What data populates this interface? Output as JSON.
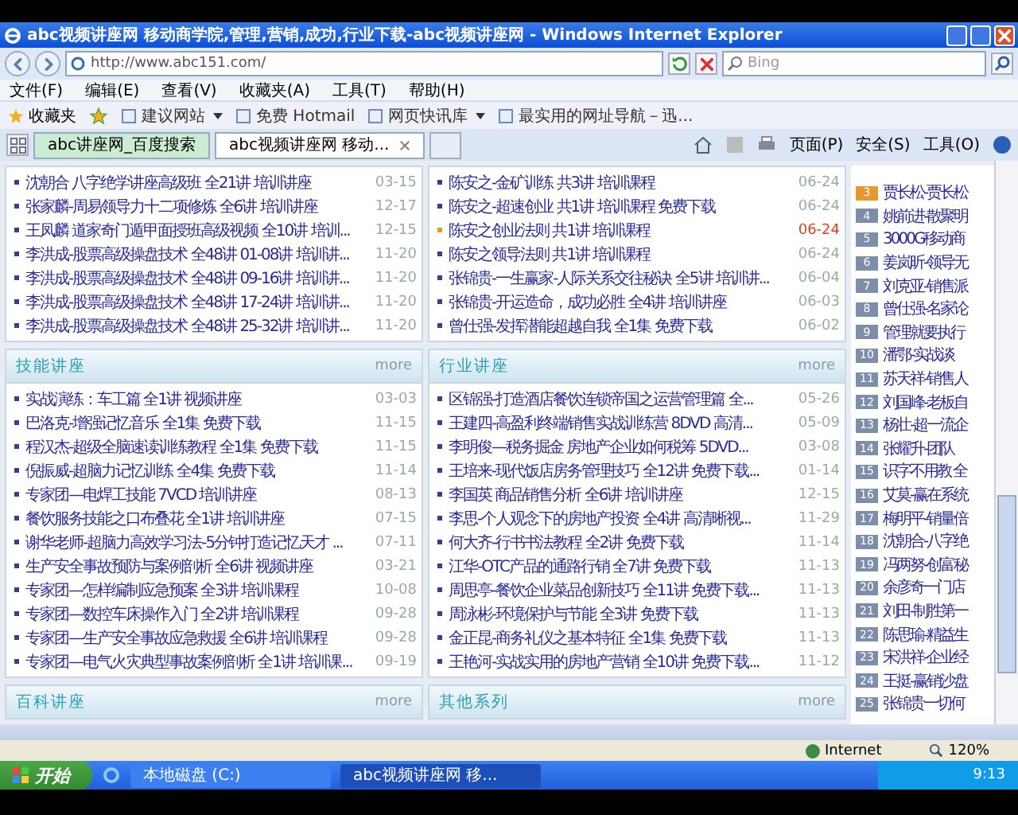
{
  "window": {
    "title": "abc视频讲座网 移动商学院,管理,营销,成功,行业下载-abc视频讲座网 - Windows Internet Explorer"
  },
  "address_bar": {
    "value": "http://www.abc151.com/",
    "search_placeholder": "Bing"
  },
  "menu": [
    "文件(F)",
    "编辑(E)",
    "查看(V)",
    "收藏夹(A)",
    "工具(T)",
    "帮助(H)"
  ],
  "favorites_bar": {
    "label": "收藏夹",
    "links": [
      {
        "label": "建议网站",
        "dropdown": true
      },
      {
        "label": "免费 Hotmail",
        "dropdown": false
      },
      {
        "label": "网页快讯库",
        "dropdown": true
      },
      {
        "label": "最实用的网址导航－迅...",
        "dropdown": false
      }
    ]
  },
  "tabs": [
    {
      "label": "abc讲座网_百度搜索",
      "selected": false
    },
    {
      "label": "abc视频讲座网 移动...",
      "selected": true
    }
  ],
  "command_bar": [
    "页面(P)",
    "安全(S)",
    "工具(O)"
  ],
  "columns": [
    {
      "top_rows": [
        {
          "title": "沈朝合 八字绝学讲座高级班 全21讲 培训讲座",
          "date": "03-15",
          "highlight": false
        },
        {
          "title": "张家麟-周易领导力十二项修炼 全6讲 培训讲座",
          "date": "12-17",
          "highlight": false
        },
        {
          "title": "王凤麟 道家奇门遁甲面授班高级视频 全10讲 培训...",
          "date": "12-15",
          "highlight": false
        },
        {
          "title": "李洪成-股票高级操盘技术 全48讲 01-08讲 培训讲...",
          "date": "11-20",
          "highlight": false
        },
        {
          "title": "李洪成-股票高级操盘技术 全48讲 09-16讲 培训讲...",
          "date": "11-20",
          "highlight": false
        },
        {
          "title": "李洪成-股票高级操盘技术 全48讲 17-24讲 培训讲...",
          "date": "11-20",
          "highlight": false
        },
        {
          "title": "李洪成-股票高级操盘技术 全48讲 25-32讲 培训讲...",
          "date": "11-20",
          "highlight": false
        }
      ],
      "sections": [
        {
          "heading": "技能讲座",
          "more": "more",
          "rows": [
            {
              "title": "实战演练：车工篇 全1讲 视频讲座",
              "date": "03-03",
              "highlight": false
            },
            {
              "title": "巴洛克-增强记忆音乐 全1集 免费下载",
              "date": "11-15",
              "highlight": false
            },
            {
              "title": "程汉杰-超级全脑速读训练教程 全1集 免费下载",
              "date": "11-15",
              "highlight": false
            },
            {
              "title": "倪振威-超脑力记忆训练 全4集 免费下载",
              "date": "11-14",
              "highlight": false
            },
            {
              "title": "专家团—电焊工技能 7VCD 培训讲座",
              "date": "08-13",
              "highlight": false
            },
            {
              "title": "餐饮服务技能之口布叠花 全1讲 培训讲座",
              "date": "07-15",
              "highlight": false
            },
            {
              "title": "谢华老师-超脑力高效学习法-5分钟打造记忆天才 ...",
              "date": "07-11",
              "highlight": false
            },
            {
              "title": "生产安全事故预防与案例剖析 全6讲 视频讲座",
              "date": "03-21",
              "highlight": false
            },
            {
              "title": "专家团—怎样编制应急预案 全3讲 培训课程",
              "date": "10-08",
              "highlight": false
            },
            {
              "title": "专家团—数控车床操作入门 全2讲 培训课程",
              "date": "09-28",
              "highlight": false
            },
            {
              "title": "专家团—生产安全事故应急救援 全6讲 培训课程",
              "date": "09-28",
              "highlight": false
            },
            {
              "title": "专家团—电气火灾典型事故案例剖析 全1讲 培训课...",
              "date": "09-19",
              "highlight": false
            }
          ]
        },
        {
          "heading": "百科讲座",
          "more": "more"
        }
      ]
    },
    {
      "top_rows": [
        {
          "title": "陈安之-金矿训练 共3讲 培训课程",
          "date": "06-24",
          "highlight": false
        },
        {
          "title": "陈安之-超速创业 共1讲 培训课程 免费下载",
          "date": "06-24",
          "highlight": false
        },
        {
          "title": "陈安之创业法则 共1讲 培训课程",
          "date": "06-24",
          "highlight": true
        },
        {
          "title": "陈安之领导法则 共1讲 培训课程",
          "date": "06-24",
          "highlight": false
        },
        {
          "title": "张锦贵-一生赢家-人际关系交往秘诀 全5讲 培训讲...",
          "date": "06-04",
          "highlight": false
        },
        {
          "title": "张锦贵-开运造命，成功必胜 全4讲 培训讲座",
          "date": "06-03",
          "highlight": false
        },
        {
          "title": "曾仕强-发挥潜能超越自我 全1集 免费下载",
          "date": "06-02",
          "highlight": false
        }
      ],
      "sections": [
        {
          "heading": "行业讲座",
          "more": "more",
          "rows": [
            {
              "title": "区锦强-打造酒店餐饮连锁帝国之运营管理篇 全...",
              "date": "05-26",
              "highlight": false
            },
            {
              "title": "王建四-高盈利终端销售实战训练营 8DVD 高清...",
              "date": "05-09",
              "highlight": false
            },
            {
              "title": "李明俊—税务掘金 房地产企业如何税筹 5DVD...",
              "date": "03-08",
              "highlight": false
            },
            {
              "title": "王培来-现代饭店房务管理技巧 全12讲 免费下载...",
              "date": "01-14",
              "highlight": false
            },
            {
              "title": "李国英 商品销售分析 全6讲 培训讲座",
              "date": "12-15",
              "highlight": false
            },
            {
              "title": "李思-个人观念下的房地产投资 全4讲 高清晰视...",
              "date": "11-29",
              "highlight": false
            },
            {
              "title": "何大齐-行书书法教程 全2讲 免费下载",
              "date": "11-14",
              "highlight": false
            },
            {
              "title": "江华-OTC产品的通路行销 全7讲 免费下载",
              "date": "11-13",
              "highlight": false
            },
            {
              "title": "周思亭-餐饮企业菜品创新技巧 全11讲 免费下载...",
              "date": "11-13",
              "highlight": false
            },
            {
              "title": "周泳彬-环境保护与节能 全3讲 免费下载",
              "date": "11-13",
              "highlight": false
            },
            {
              "title": "金正昆-商务礼仪之基本特征 全1集 免费下载",
              "date": "11-13",
              "highlight": false
            },
            {
              "title": "王艳河-实战实用的房地产营销 全10讲 免费下载...",
              "date": "11-12",
              "highlight": false
            }
          ]
        },
        {
          "heading": "其他系列",
          "more": "more"
        }
      ]
    }
  ],
  "ranking": [
    {
      "rank": "3",
      "title": "贾长松-贾长松",
      "color": "#e8962e"
    },
    {
      "rank": "4",
      "title": "姚前进-散聚明",
      "color": "#7d8eaa"
    },
    {
      "rank": "5",
      "title": "3000G移动商",
      "color": "#7d8eaa"
    },
    {
      "rank": "6",
      "title": "姜岚昕-领导无",
      "color": "#7d8eaa"
    },
    {
      "rank": "7",
      "title": "刘克亚-销售派",
      "color": "#7d8eaa"
    },
    {
      "rank": "8",
      "title": "曾仕强-名家论",
      "color": "#7d8eaa"
    },
    {
      "rank": "9",
      "title": "管理就要执行",
      "color": "#7d8eaa"
    },
    {
      "rank": "10",
      "title": "潘鄂-实战谈",
      "color": "#7d8eaa"
    },
    {
      "rank": "11",
      "title": "苏天祥-销售人",
      "color": "#7d8eaa"
    },
    {
      "rank": "12",
      "title": "刘国峰-老板自",
      "color": "#7d8eaa"
    },
    {
      "rank": "13",
      "title": "杨壮-超一流企",
      "color": "#7d8eaa"
    },
    {
      "rank": "14",
      "title": "张耀升-团队",
      "color": "#7d8eaa"
    },
    {
      "rank": "15",
      "title": "识字不用教 全",
      "color": "#7d8eaa"
    },
    {
      "rank": "16",
      "title": "艾莫-赢在系统",
      "color": "#7d8eaa"
    },
    {
      "rank": "17",
      "title": "梅明平-销量倍",
      "color": "#7d8eaa"
    },
    {
      "rank": "18",
      "title": "沈朝合-八字绝",
      "color": "#7d8eaa"
    },
    {
      "rank": "19",
      "title": "冯两努-创富秘",
      "color": "#7d8eaa"
    },
    {
      "rank": "20",
      "title": "余彦奇一门店",
      "color": "#7d8eaa"
    },
    {
      "rank": "21",
      "title": "刘田-制胜第一",
      "color": "#7d8eaa"
    },
    {
      "rank": "22",
      "title": "陈思瑜-精益生",
      "color": "#7d8eaa"
    },
    {
      "rank": "23",
      "title": "宋洪祥-企业经",
      "color": "#7d8eaa"
    },
    {
      "rank": "24",
      "title": "王挺-赢销沙盘",
      "color": "#7d8eaa"
    },
    {
      "rank": "25",
      "title": "张锦贵一切何",
      "color": "#7d8eaa"
    }
  ],
  "status_bar": {
    "zone": "Internet",
    "zoom": "120%"
  },
  "taskbar": {
    "start": "开始",
    "windows": [
      {
        "label": "本地磁盘 (C:)",
        "selected": false
      },
      {
        "label": "abc视频讲座网 移...",
        "selected": true
      }
    ],
    "clock": "9:13"
  }
}
